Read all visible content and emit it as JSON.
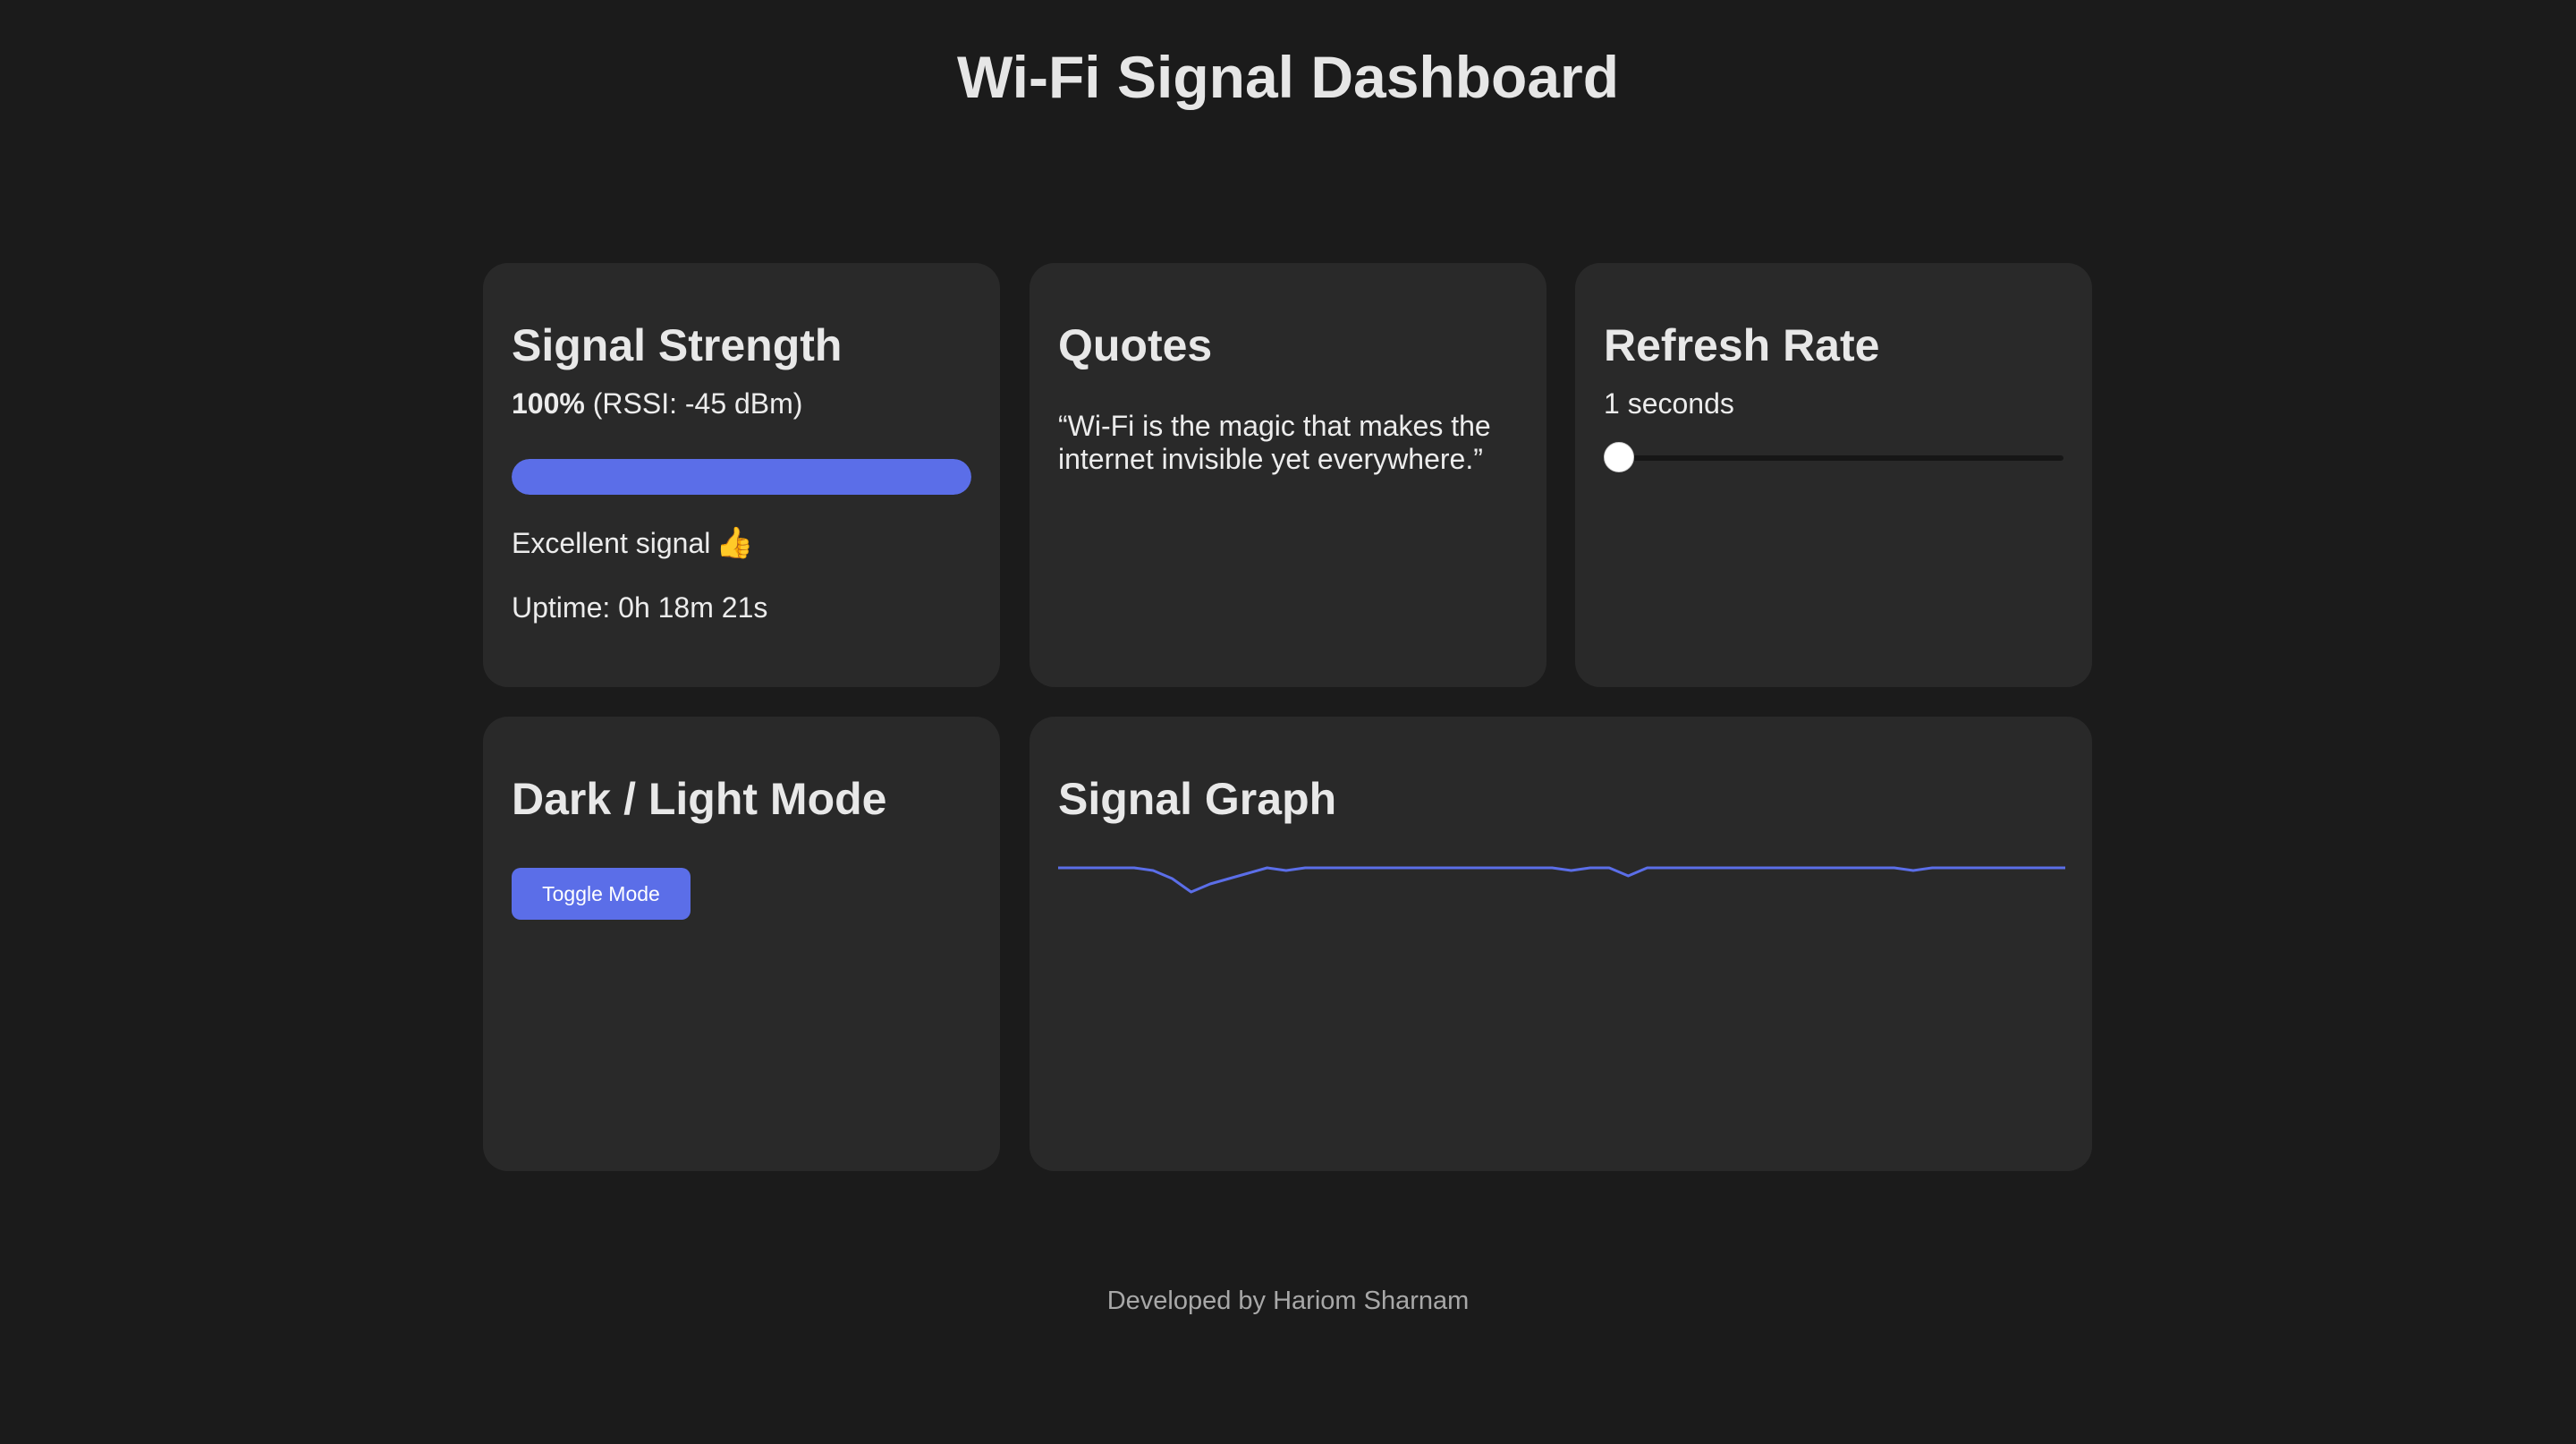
{
  "page": {
    "title": "Wi-Fi Signal Dashboard",
    "footer": "Developed by Hariom Sharnam"
  },
  "signal_card": {
    "title": "Signal Strength",
    "percent_text": "100%",
    "rssi_text": "(RSSI: -45 dBm)",
    "percent_value": 100,
    "status_text": "Excellent signal",
    "status_icon": "thumbs-up-icon",
    "uptime_text": "Uptime: 0h 18m 21s"
  },
  "quotes_card": {
    "title": "Quotes",
    "quote": "“Wi-Fi is the magic that makes the internet invisible yet everywhere.”"
  },
  "refresh_card": {
    "title": "Refresh Rate",
    "value_text": "1 seconds",
    "slider_value": 1,
    "slider_min": 1,
    "slider_max": 60
  },
  "mode_card": {
    "title": "Dark / Light Mode",
    "button_label": "Toggle Mode"
  },
  "graph_card": {
    "title": "Signal Graph"
  },
  "chart_data": {
    "type": "line",
    "ylim": [
      0,
      100
    ],
    "series": [
      {
        "values": [
          100,
          100,
          100,
          100,
          100,
          99,
          96,
          91,
          94,
          96,
          98,
          100,
          99,
          100,
          100,
          100,
          100,
          100,
          100,
          100,
          100,
          100,
          100,
          100,
          100,
          100,
          100,
          99,
          100,
          100,
          97,
          100,
          100,
          100,
          100,
          100,
          100,
          100,
          100,
          100,
          100,
          100,
          100,
          100,
          100,
          99,
          100,
          100,
          100,
          100,
          100,
          100,
          100,
          100
        ]
      }
    ],
    "grid": false,
    "colors": {
      "line": "#5b6ee8"
    }
  },
  "colors": {
    "background": "#1b1b1b",
    "card": "#292929",
    "accent": "#5b6ee8"
  }
}
